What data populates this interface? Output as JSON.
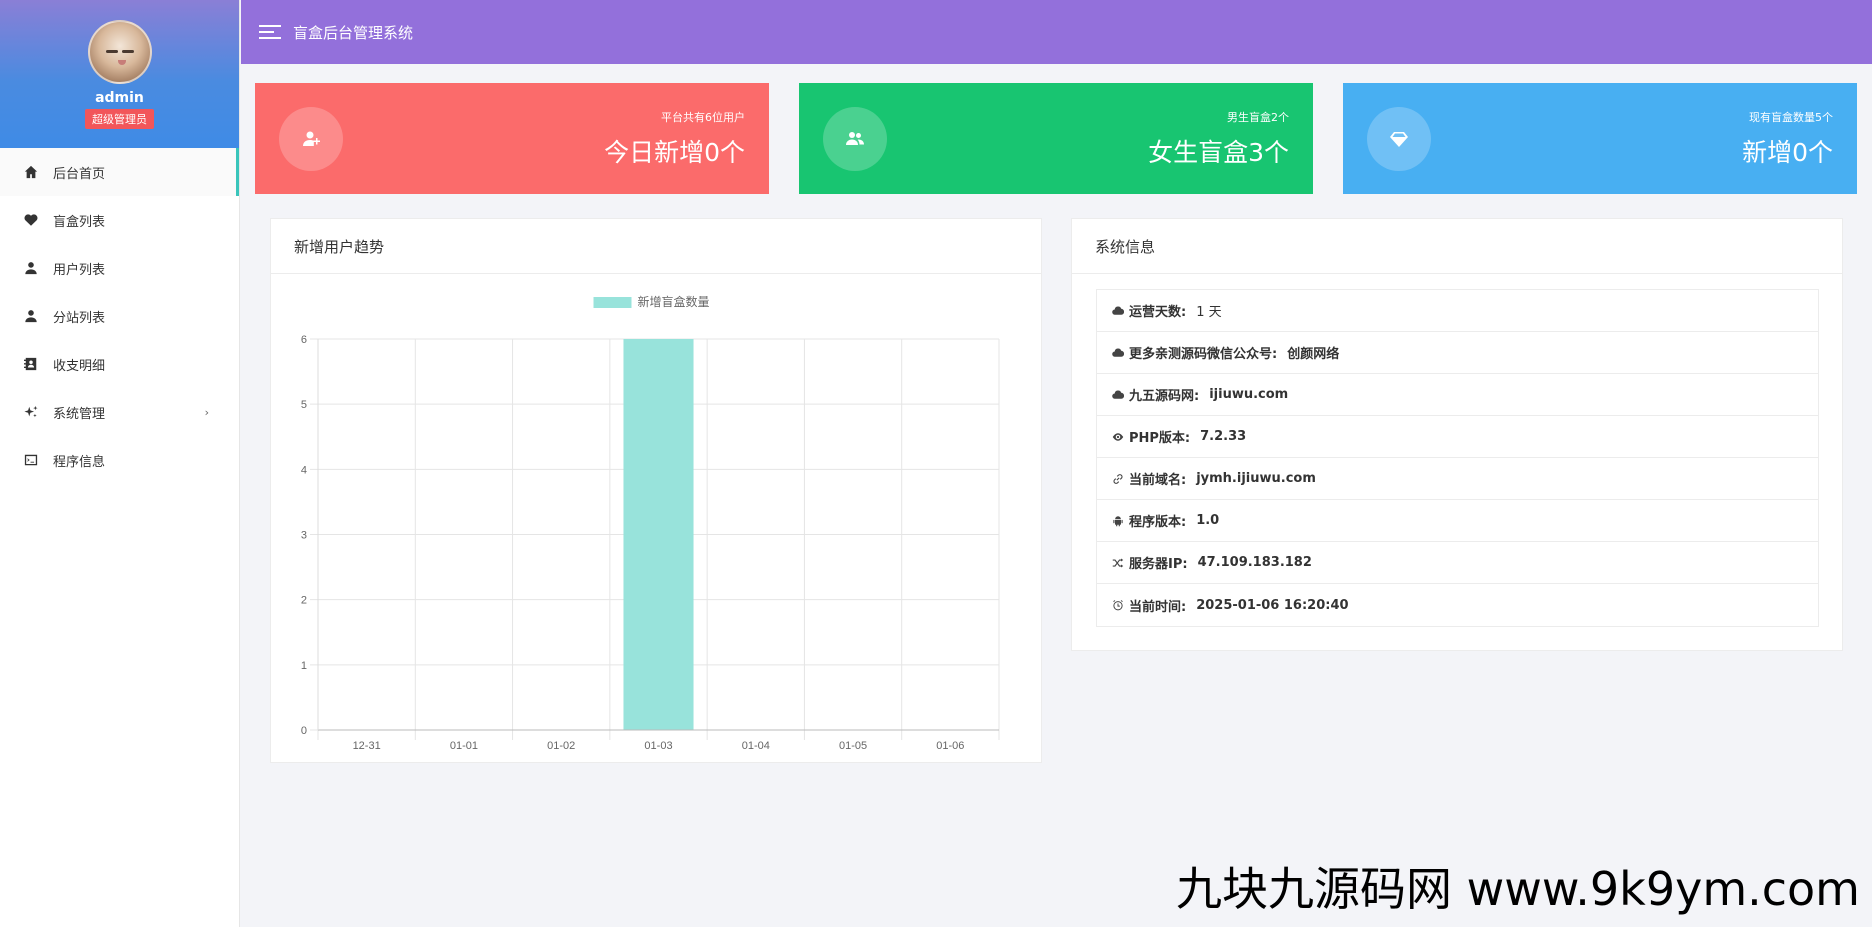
{
  "header": {
    "title": "盲盒后台管理系统"
  },
  "profile": {
    "username": "admin",
    "role": "超级管理员"
  },
  "sidebar": {
    "items": [
      {
        "label": "后台首页",
        "icon": "home-icon",
        "active": true
      },
      {
        "label": "盲盒列表",
        "icon": "heart-icon"
      },
      {
        "label": "用户列表",
        "icon": "user-icon"
      },
      {
        "label": "分站列表",
        "icon": "user-icon"
      },
      {
        "label": "收支明细",
        "icon": "contacts-book-icon"
      },
      {
        "label": "系统管理",
        "icon": "sparkle-icon",
        "has_submenu": true
      },
      {
        "label": "程序信息",
        "icon": "terminal-icon"
      }
    ],
    "submenu_arrow": "›"
  },
  "stats": [
    {
      "small": "平台共有6位用户",
      "big": "今日新增0个",
      "color": "#fb6b6b",
      "icon": "user-add-icon"
    },
    {
      "small": "男生盲盒2个",
      "big": "女生盲盒3个",
      "color": "#18c571",
      "icon": "users-icon"
    },
    {
      "small": "现有盲盒数量5个",
      "big": "新增0个",
      "color": "#48aff2",
      "icon": "diamond-icon"
    }
  ],
  "chart_panel": {
    "title": "新增用户趋势"
  },
  "chart_data": {
    "type": "bar",
    "categories": [
      "12-31",
      "01-01",
      "01-02",
      "01-03",
      "01-04",
      "01-05",
      "01-06"
    ],
    "series": [
      {
        "name": "新增盲盒数量",
        "values": [
          0,
          0,
          0,
          6,
          0,
          0,
          0
        ],
        "color": "#98e3db"
      }
    ],
    "ylim": [
      0,
      6
    ],
    "yticks": [
      "0",
      "1",
      "2",
      "3",
      "4",
      "5",
      "6"
    ],
    "grid": true,
    "legend": "top-center"
  },
  "info_panel": {
    "title": "系统信息",
    "rows": [
      {
        "label": "运营天数:",
        "value": "1 天",
        "icon": "cloud-icon",
        "bold_value": false
      },
      {
        "label": "更多亲测源码微信公众号:",
        "value": "创颜网络",
        "icon": "cloud-icon",
        "bold_value": true
      },
      {
        "label": "九五源码网:",
        "value": "ijiuwu.com",
        "icon": "cloud-icon",
        "bold_value": true
      },
      {
        "label": "PHP版本:",
        "value": "7.2.33",
        "icon": "eye-icon",
        "bold_value": true
      },
      {
        "label": "当前域名:",
        "value": "jymh.ijiuwu.com",
        "icon": "link-icon",
        "bold_value": true
      },
      {
        "label": "程序版本:",
        "value": "1.0",
        "icon": "android-icon",
        "bold_value": true
      },
      {
        "label": "服务器IP:",
        "value": "47.109.183.182",
        "icon": "shuffle-icon",
        "bold_value": true
      },
      {
        "label": "当前时间:",
        "value": "2025-01-06 16:20:40",
        "icon": "clock-icon",
        "bold_value": true
      }
    ]
  },
  "watermark": "九块九源码网 www.9k9ym.com"
}
